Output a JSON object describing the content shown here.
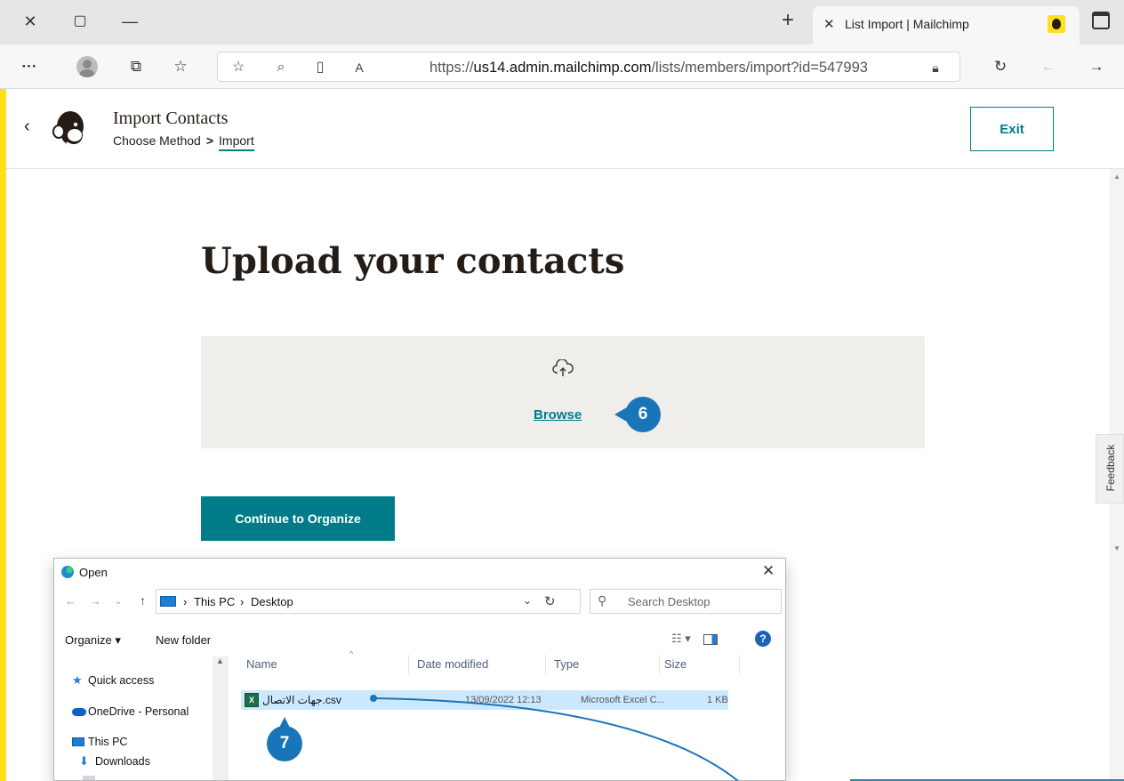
{
  "browser": {
    "tab_title": "List Import | Mailchimp",
    "new_tab_symbol": "+",
    "url_prefix": "https://",
    "url_host": "us14.admin.mailchimp.com",
    "url_path": "/lists/members/import?id=547993",
    "window_controls": [
      "close-icon",
      "maximize-icon",
      "minimize-icon"
    ],
    "toolbar_icons": [
      "more-icon",
      "profile-icon",
      "collections-icon",
      "favorites-icon",
      "add-favorite-icon",
      "zoom-icon",
      "immersive-reader-icon",
      "read-aloud-icon",
      "lock-icon",
      "refresh-icon",
      "back-icon",
      "forward-icon"
    ]
  },
  "header": {
    "title": "Import Contacts",
    "crumb_1": "Choose Method",
    "crumb_sep": ">",
    "crumb_2": "Import",
    "exit_label": "Exit"
  },
  "main": {
    "headline": "Upload your contacts",
    "browse_label": "Browse",
    "continue_label": "Continue to Organize",
    "feedback_label": "Feedback"
  },
  "steps": {
    "browse_step": "6",
    "file_step": "7"
  },
  "dialog": {
    "title": "Open",
    "path_1": "This PC",
    "path_2": "Desktop",
    "search_placeholder": "Search Desktop",
    "organize_label": "Organize ▾",
    "new_folder_label": "New folder",
    "help_label": "?",
    "nav": {
      "quick_access": "Quick access",
      "onedrive": "OneDrive - Personal",
      "this_pc": "This PC",
      "downloads": "Downloads"
    },
    "columns": {
      "name": "Name",
      "date": "Date modified",
      "type": "Type",
      "size": "Size"
    },
    "file": {
      "name": "جهات الاتصال.csv",
      "date": "13/09/2022 12:13",
      "type": "Microsoft Excel C...",
      "size": "1 KB"
    }
  },
  "colors": {
    "brand_yellow": "#ffe01b",
    "teal": "#007c89",
    "step_blue": "#1a74b8"
  }
}
